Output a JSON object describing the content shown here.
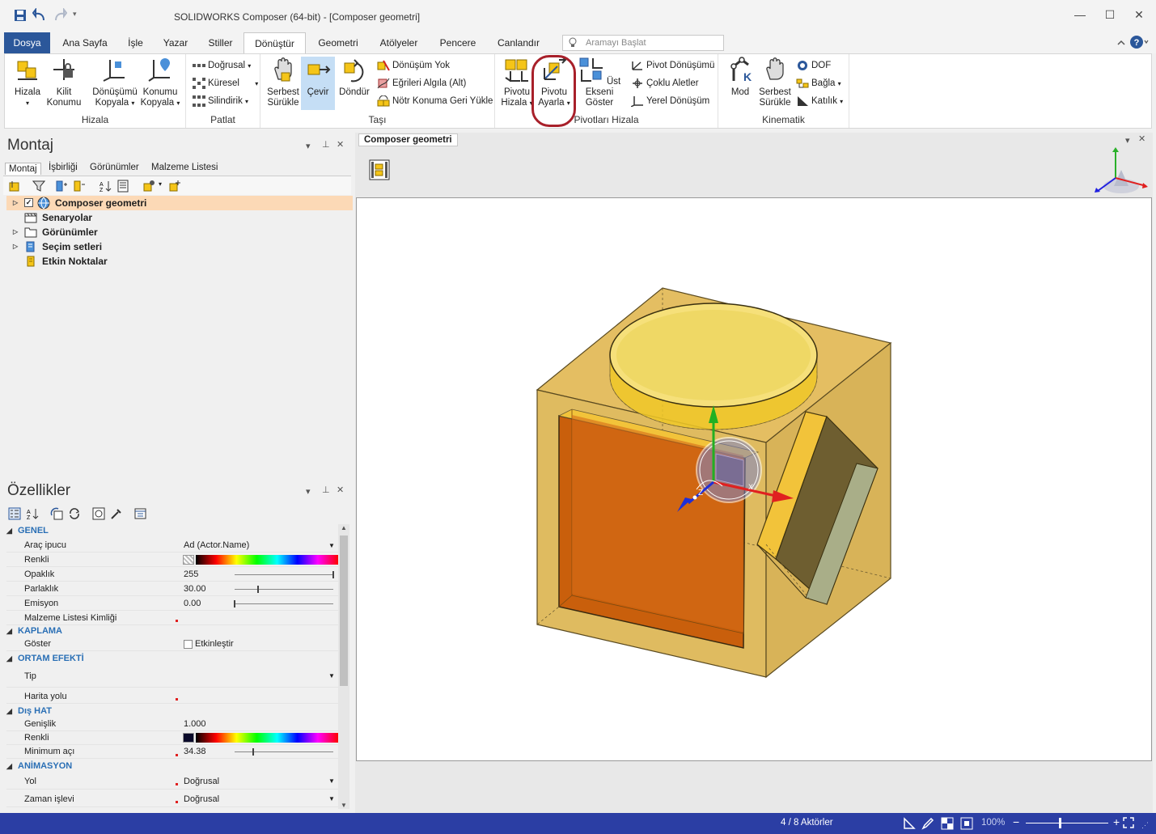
{
  "titlebar": {
    "title": "SOLIDWORKS Composer (64-bit) - [Composer geometri]"
  },
  "tabs": [
    "Dosya",
    "Ana Sayfa",
    "İşle",
    "Yazar",
    "Stiller",
    "Dönüştür",
    "Geometri",
    "Atölyeler",
    "Pencere",
    "Canlandır"
  ],
  "search": {
    "placeholder": "Aramayı Başlat"
  },
  "ribbon": {
    "hizala": {
      "label": "Hizala",
      "b1": "Hizala",
      "b2": "Kilit",
      "b2b": "Konumu",
      "b3": "Dönüşümü",
      "b3b": "Kopyala",
      "b4": "Konumu",
      "b4b": "Kopyala"
    },
    "patlat": {
      "label": "Patlat",
      "s1": "Doğrusal",
      "s2": "Küresel",
      "s3": "Silindirik"
    },
    "tasi": {
      "label": "Taşı",
      "b1": "Serbest",
      "b1b": "Sürükle",
      "b2": "Çevir",
      "b3": "Döndür",
      "s1": "Dönüşüm Yok",
      "s2": "Eğrileri Algıla (Alt)",
      "s3": "Nötr Konuma Geri Yükle"
    },
    "pivot": {
      "label": "Pivotları Hizala",
      "b1": "Pivotu",
      "b1b": "Hizala",
      "b2": "Pivotu",
      "b2b": "Ayarla",
      "b3": "Üst Ekseni",
      "b3b": "Göster",
      "s1": "Pivot Dönüşümü",
      "s2": "Çoklu Aletler",
      "s3": "Yerel Dönüşüm"
    },
    "kinematik": {
      "label": "Kinematik",
      "b1": "Mod",
      "b2": "Serbest",
      "b2b": "Sürükle",
      "s1": "DOF",
      "s2": "Bağla",
      "s3": "Katılık"
    }
  },
  "leftpanel": {
    "title": "Montaj",
    "subtabs": [
      "Montaj",
      "İşbirliği",
      "Görünümler",
      "Malzeme Listesi"
    ],
    "tree": [
      "Composer geometri",
      "Senaryolar",
      "Görünümler",
      "Seçim setleri",
      "Etkin Noktalar"
    ]
  },
  "props": {
    "title": "Özellikler",
    "genel": "GENEL",
    "arac": "Araç ipucu",
    "arac_v": "Ad (Actor.Name)",
    "renkli": "Renkli",
    "opaklik": "Opaklık",
    "opaklik_v": "255",
    "opaklik_level": 1.0,
    "parlaklik": "Parlaklık",
    "parlaklik_v": "30.00",
    "parlaklik_level": 0.24,
    "emisyon": "Emisyon",
    "emisyon_v": "0.00",
    "emisyon_level": 0.0,
    "malzeme": "Malzeme Listesi Kimliği",
    "kaplama": "KAPLAMA",
    "goster": "Göster",
    "goster_v": "Etkinleştir",
    "ortam": "ORTAM EFEKTİ",
    "tip": "Tip",
    "harita": "Harita yolu",
    "dishat": "Dış HAT",
    "genislik": "Genişlik",
    "genislik_v": "1.000",
    "renkli2": "Renkli",
    "minaci": "Minimum açı",
    "minaci_v": "34.38",
    "minaci_level": 0.19,
    "animasyon": "ANİMASYON",
    "yol": "Yol",
    "yol_v": "Doğrusal",
    "zaman": "Zaman işlevi",
    "zaman_v": "Doğrusal"
  },
  "viewport": {
    "tab": "Composer geometri"
  },
  "status": {
    "actors": "4 / 8 Aktörler",
    "zoom": "100%"
  },
  "colors": {
    "accent": "#2b579a",
    "status": "#2b3ea4",
    "highlight": "#a8202a"
  }
}
